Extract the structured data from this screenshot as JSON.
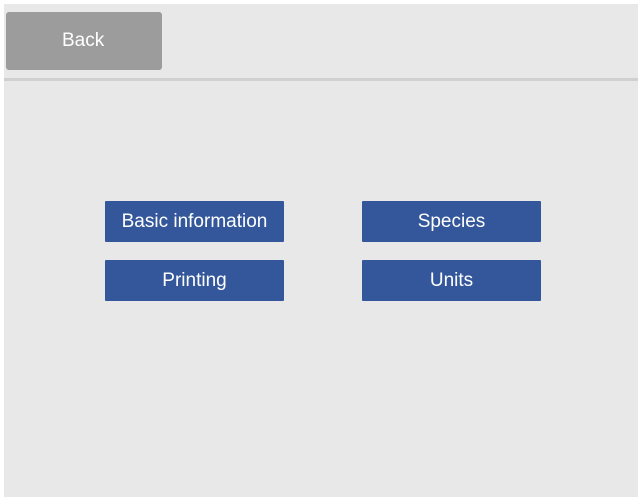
{
  "header": {
    "back_label": "Back"
  },
  "menu": {
    "items": [
      {
        "label": "Basic information"
      },
      {
        "label": "Species"
      },
      {
        "label": "Printing"
      },
      {
        "label": "Units"
      }
    ]
  },
  "colors": {
    "background": "#e8e8e8",
    "back_button": "#9c9c9c",
    "menu_button": "#33579a",
    "divider": "#d0d0d0"
  }
}
